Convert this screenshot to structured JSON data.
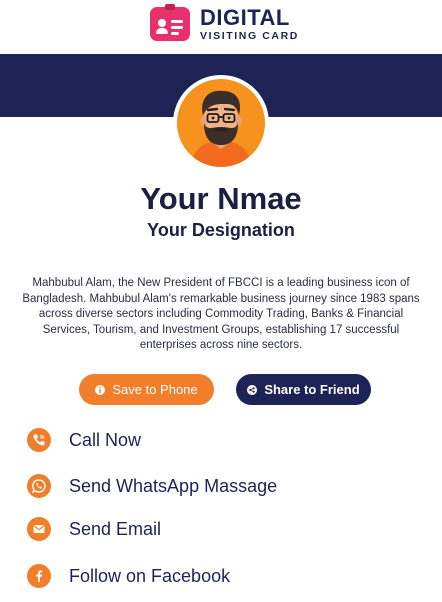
{
  "brand": {
    "name_main": "DIGITAL",
    "name_sub": "VISITING CARD",
    "color": "#1e2356",
    "accent": "#e8306a"
  },
  "profile": {
    "name": "Your Nmae",
    "designation": "Your Designation",
    "bio": "Mahbubul Alam, the New President of FBCCI is a leading business icon of Bangladesh. Mahbubul Alam's remarkable business journey since 1983 spans across diverse sectors including Commodity Trading, Banks & Financial Services, Tourism, and Investment Groups, establishing 17 successful enterprises across nine sectors."
  },
  "buttons": {
    "save": {
      "label": "Save to Phone",
      "icon": "info-circle-icon",
      "color": "#f07e2a"
    },
    "share": {
      "label": "Share to Friend",
      "icon": "share-circle-icon",
      "color": "#1e2356"
    }
  },
  "actions": [
    {
      "label": "Call Now",
      "icon": "phone-icon"
    },
    {
      "label": "Send WhatsApp Massage",
      "icon": "whatsapp-icon"
    },
    {
      "label": "Send Email",
      "icon": "mail-icon"
    },
    {
      "label": "Follow on Facebook",
      "icon": "facebook-icon"
    }
  ]
}
